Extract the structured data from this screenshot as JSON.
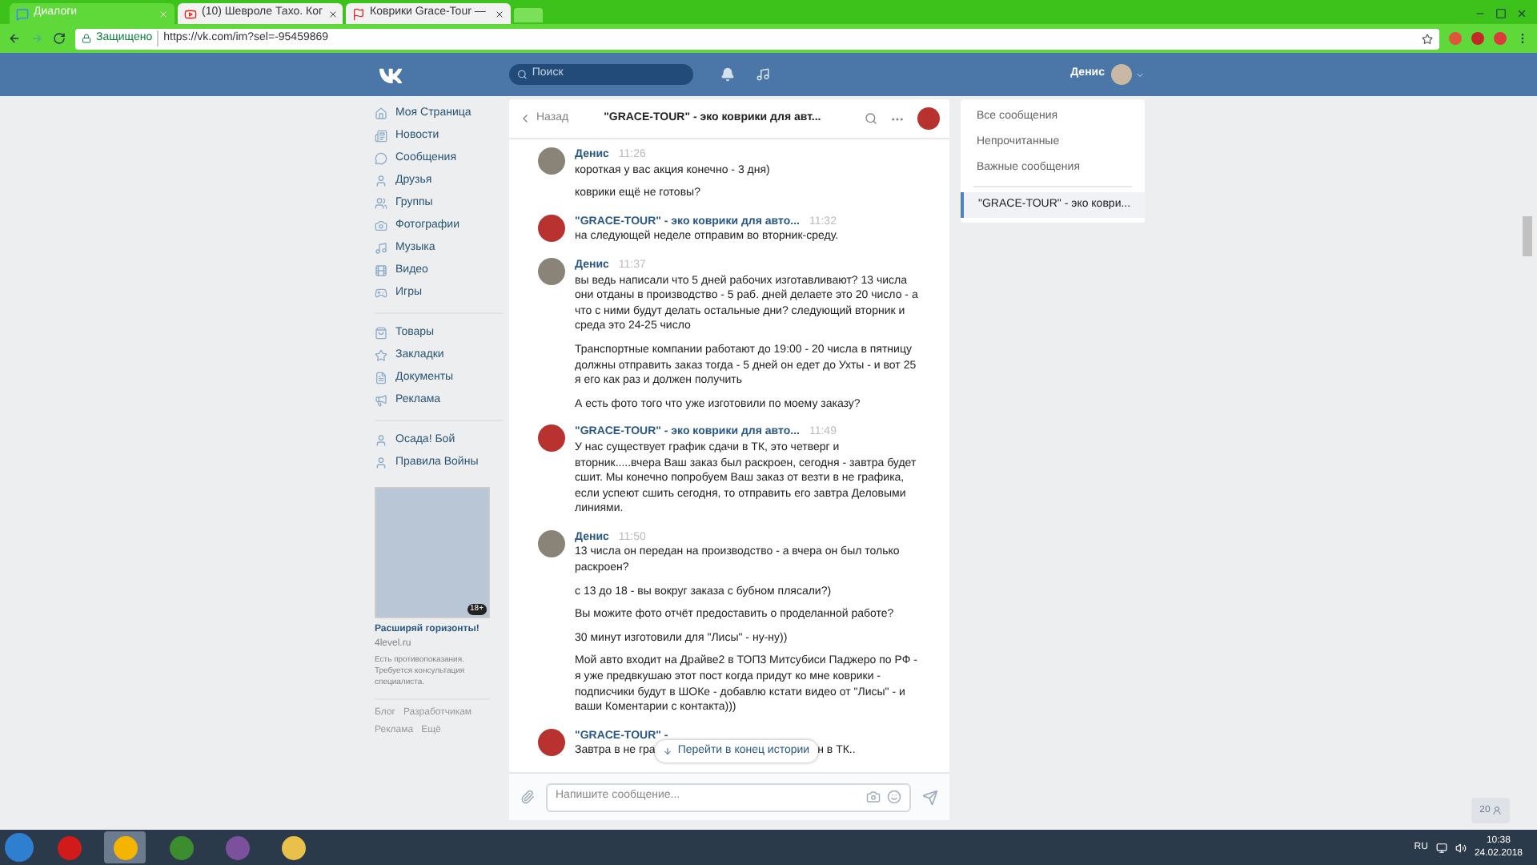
{
  "browser": {
    "tabs": [
      {
        "label": "Диалоги",
        "selected": true,
        "kind": "chat"
      },
      {
        "label": "(10) Шевроле Тахо. Ког",
        "selected": false,
        "kind": "video"
      },
      {
        "label": "Коврики Grace-Tour —",
        "selected": false,
        "kind": "drive"
      }
    ],
    "secure_label": "Защищено",
    "url": "https://vk.com/im?sel=-95459869"
  },
  "header": {
    "search": {
      "placeholder": "Поиск"
    },
    "user_name": "Денис"
  },
  "sidebar": {
    "groups": [
      [
        {
          "label": "Моя Страница",
          "kind": "home"
        },
        {
          "label": "Новости",
          "kind": "news"
        },
        {
          "label": "Сообщения",
          "kind": "messages"
        },
        {
          "label": "Друзья",
          "kind": "friend"
        },
        {
          "label": "Группы",
          "kind": "groups"
        },
        {
          "label": "Фотографии",
          "kind": "camera"
        },
        {
          "label": "Музыка",
          "kind": "music"
        },
        {
          "label": "Видео",
          "kind": "video"
        },
        {
          "label": "Игры",
          "kind": "games"
        }
      ],
      [
        {
          "label": "Товары",
          "kind": "bag"
        },
        {
          "label": "Закладки",
          "kind": "star"
        },
        {
          "label": "Документы",
          "kind": "doc"
        },
        {
          "label": "Реклама",
          "kind": "ads"
        }
      ],
      [
        {
          "label": "Осада! Бой",
          "kind": "app"
        },
        {
          "label": "Правила Войны",
          "kind": "app"
        }
      ]
    ],
    "ad": {
      "age_badge": "18+",
      "title": "Расширяй горизонты!",
      "domain": "4level.ru",
      "disclaimer": "Есть противопоказания. Требуется консультация специалиста."
    },
    "footer_links": [
      "Блог",
      "Разработчикам",
      "Реклама",
      "Ещё"
    ]
  },
  "chat": {
    "back": "Назад",
    "title": "\"GRACE-TOUR\" - эко коврики для авт...",
    "messages": [
      {
        "kind": "user",
        "author": "Денис",
        "time": "11:26",
        "texts": [
          "короткая у вас акция конечно - 3 дня)",
          "коврики ещё не готовы?"
        ]
      },
      {
        "kind": "group",
        "author": "\"GRACE-TOUR\" - эко коврики для авто...",
        "time": "11:32",
        "texts": [
          "на следующей неделе отправим во вторник-среду."
        ]
      },
      {
        "kind": "user",
        "author": "Денис",
        "time": "11:37",
        "texts": [
          "вы ведь написали что 5 дней рабочих изготавливают? 13 числа они отданы в производство - 5 раб. дней делаете это 20 число - а что с ними будут делать остальные дни? следующий вторник и среда это 24-25 число",
          "Транспортные компании работают до 19:00 - 20 числа в пятницу должны отправить заказ тогда - 5 дней он едет до Ухты - и вот 25 я его как раз и должен получить",
          "А есть фото того что уже изготовили по моему заказу?"
        ]
      },
      {
        "kind": "group",
        "author": "\"GRACE-TOUR\" - эко коврики для авто...",
        "time": "11:49",
        "texts": [
          "У нас существует график сдачи в ТК, это четверг и вторник.....вчера Ваш заказ был раскроен, сегодня - завтра будет сшит. Мы конечно попробуем Ваш заказ от везти в не графика, если успеют сшить сегодня, то отправить его завтра Деловыми линиями."
        ]
      },
      {
        "kind": "user",
        "author": "Денис",
        "time": "11:50",
        "texts": [
          "13 числа он передан на производство - а вчера он был только раскроен?",
          "с 13 до 18 - вы вокруг заказа с бубном плясали?)",
          "Вы можите фото отчёт предоставить о проделанной работе?",
          "30 минут изготовили для \"Лисы\" - ну-ну))",
          "Мой авто входит на Драйве2 в ТОП3 Митсубиси Паджеро по РФ - я уже предвкушаю этот пост когда придут ко мне коврики - подписчики будут в ШОКе - добавлю кстати видео от \"Лисы\" - и ваши Коментарии с контакта)))"
        ]
      }
    ],
    "partial": {
      "author": "\"GRACE-TOUR\" -",
      "text_start": "Завтра в не гра",
      "text_end": "н в ТК.."
    },
    "jump_button": "Перейти в конец истории",
    "input": {
      "placeholder": "Напишите сообщение..."
    }
  },
  "filters": [
    {
      "label": "Все сообщения",
      "selected": false
    },
    {
      "label": "Непрочитанные",
      "selected": false
    },
    {
      "label": "Важные сообщения",
      "selected": false
    }
  ],
  "open_dialogs": [
    {
      "label": "\"GRACE-TOUR\" - эко коври...",
      "selected": true
    }
  ],
  "online_badge": "20",
  "taskbar": {
    "apps": [
      {
        "kind": "opera",
        "active": false
      },
      {
        "kind": "chrome",
        "active": true
      },
      {
        "kind": "torrent",
        "active": false
      },
      {
        "kind": "viber",
        "active": false
      },
      {
        "kind": "folder",
        "active": false
      }
    ],
    "lang": "RU",
    "time": "10:38",
    "date": "24.02.2018"
  }
}
